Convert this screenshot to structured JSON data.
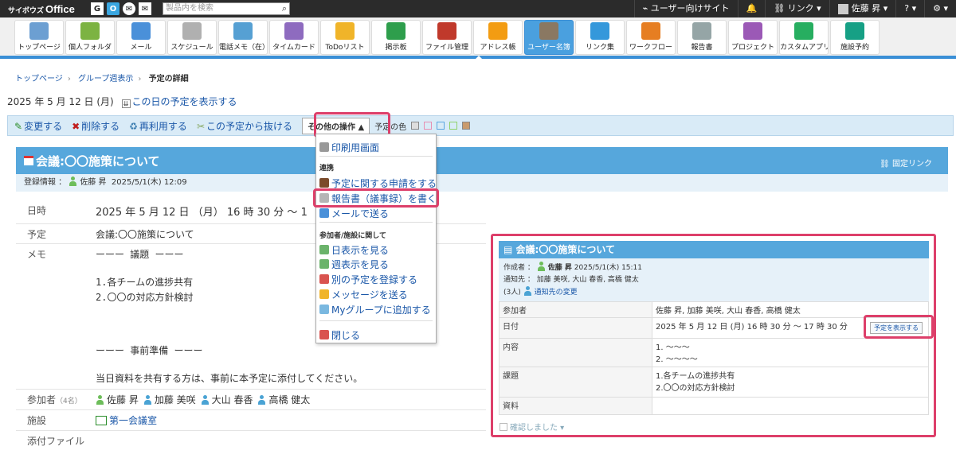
{
  "header": {
    "logo_small": "サイボウズ",
    "logo_main": "Office",
    "top_icons": [
      "G",
      "O",
      "C",
      "M"
    ],
    "search_placeholder": "製品内を検索",
    "mobile_site": "ユーザー向けサイト",
    "link_menu": "リンク",
    "user_name": "佐藤 昇",
    "help": "?"
  },
  "apps": [
    {
      "label": "トップページ",
      "icon": "home-icon",
      "color": "#6c9fd2"
    },
    {
      "label": "個人フォルダ",
      "icon": "folder-icon",
      "color": "#7cb342"
    },
    {
      "label": "メール",
      "icon": "mail-icon",
      "color": "#4a90d9"
    },
    {
      "label": "スケジュール",
      "icon": "calendar-icon",
      "color": "#b0b0b0"
    },
    {
      "label": "電話メモ（在）",
      "icon": "phone-memo-icon",
      "color": "#56a0d3"
    },
    {
      "label": "タイムカード",
      "icon": "timecard-icon",
      "color": "#8e6bbf"
    },
    {
      "label": "ToDoリスト",
      "icon": "todo-icon",
      "color": "#f0b429"
    },
    {
      "label": "掲示板",
      "icon": "board-icon",
      "color": "#2e9e4c"
    },
    {
      "label": "ファイル管理",
      "icon": "file-icon",
      "color": "#c0392b"
    },
    {
      "label": "アドレス帳",
      "icon": "address-book-icon",
      "color": "#f39c12"
    },
    {
      "label": "ユーザー名簿",
      "icon": "user-list-icon",
      "color": "#8a7862"
    },
    {
      "label": "リンク集",
      "icon": "globe-icon",
      "color": "#3498db"
    },
    {
      "label": "ワークフロー",
      "icon": "workflow-icon",
      "color": "#e67e22"
    },
    {
      "label": "報告書",
      "icon": "report-icon",
      "color": "#95a5a6"
    },
    {
      "label": "プロジェクト",
      "icon": "project-icon",
      "color": "#9b59b6"
    },
    {
      "label": "カスタムアプリ",
      "icon": "custom-app-icon",
      "color": "#27ae60"
    },
    {
      "label": "施設予約",
      "icon": "facility-icon",
      "color": "#16a085"
    }
  ],
  "active_app": 10,
  "breadcrumb": {
    "home": "トップページ",
    "group_week": "グループ週表示",
    "current": "予定の詳細"
  },
  "date_line": {
    "date": "2025 年 5 月 12 日 (月)",
    "link": "この日の予定を表示する"
  },
  "actions": {
    "edit": "変更する",
    "delete": "削除する",
    "reuse": "再利用する",
    "leave": "この予定から抜ける",
    "more": "その他の操作",
    "color_label": "予定の色"
  },
  "swatch_colors": [
    "#cccccc",
    "#e78fb3",
    "#5aa6e0",
    "#8fd16a",
    "#c99b6d"
  ],
  "event": {
    "title": "会議:〇〇施策について",
    "permalink": "固定リンク",
    "reg_label": "登録情報 ：",
    "reg_user": "佐藤 昇",
    "reg_time": "2025/5/1(木) 12:09",
    "rows": {
      "datetime_label": "日時",
      "datetime_value": "2025 年 5 月 12 日 （月） 16 時 30 分 ～ 1",
      "subject_label": "予定",
      "subject_value": "会議:〇〇施策について",
      "memo_label": "メモ",
      "memo_lines": [
        "ーーー 議題 ーーー",
        "",
        "1.各チームの進捗共有",
        "2.〇〇の対応方針検討",
        "",
        "",
        "",
        "ーーー 事前準備 ーーー",
        "",
        "当日資料を共有する方は、事前に本予定に添付してください。"
      ],
      "attendees_label": "参加者",
      "attendees_count": "（4名）",
      "attendees": [
        "佐藤 昇",
        "加藤 美咲",
        "大山 春香",
        "高橋 健太"
      ],
      "facility_label": "施設",
      "facility_value": "第一会議室",
      "attachment_label": "添付ファイル"
    }
  },
  "menu": {
    "print": "印刷用画面",
    "sec_link": "連携",
    "apply": "予定に関する申請をする",
    "report": "報告書（議事録）を書く",
    "send_mail": "メールで送る",
    "sec_participants": "参加者/施設に関して",
    "day_view": "日表示を見る",
    "week_view": "週表示を見る",
    "register_other": "別の予定を登録する",
    "message": "メッセージを送る",
    "mygroup": "Myグループに追加する",
    "close": "閉じる"
  },
  "popup": {
    "title": "会議:〇〇施策について",
    "creator_label": "作成者 ：",
    "creator": "佐藤 昇",
    "created_at": "2025/5/1(木) 15:11",
    "notify_label": "通知先 ：",
    "notify_count": "(3人)",
    "notify_users": "加藤 美咲, 大山 春香, 高橋 健太",
    "notify_change": "通知先の変更",
    "rows": [
      {
        "h": "参加者",
        "v": "佐藤 昇, 加藤 美咲, 大山 春香, 高橋 健太"
      },
      {
        "h": "日付",
        "v": "2025 年 5 月 12 日 (月) 16 時 30 分 ～ 17 時 30 分"
      },
      {
        "h": "内容",
        "v": "1. ～～～\n2. ～～～～"
      },
      {
        "h": "課題",
        "v": "1.各チームの進捗共有\n2.〇〇の対応方針検討"
      },
      {
        "h": "資料",
        "v": ""
      }
    ],
    "show_schedule_btn": "予定を表示する",
    "confirmed": "確認しました"
  }
}
